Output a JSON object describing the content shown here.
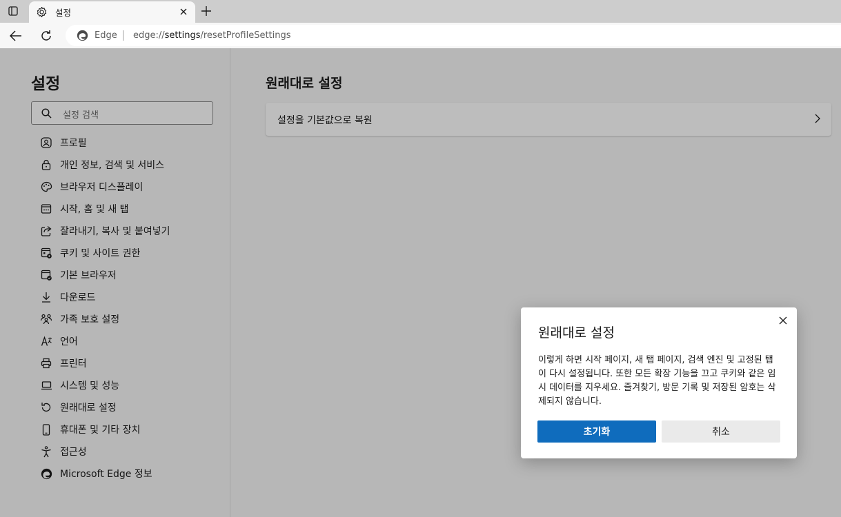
{
  "browser": {
    "tab": {
      "title": "설정",
      "icon": "gear-icon"
    },
    "address": {
      "brand": "Edge",
      "url_prefix": "edge://",
      "url_strong": "settings",
      "url_suffix": "/resetProfileSettings"
    }
  },
  "sidebar": {
    "title": "설정",
    "search_placeholder": "설정 검색",
    "items": [
      {
        "label": "프로필",
        "icon": "profile-icon"
      },
      {
        "label": "개인 정보, 검색 및 서비스",
        "icon": "lock-icon"
      },
      {
        "label": "브라우저 디스플레이",
        "icon": "palette-icon"
      },
      {
        "label": "시작, 홈 및 새 탭",
        "icon": "home-window-icon"
      },
      {
        "label": "잘라내기, 복사 및 붙여넣기",
        "icon": "share-icon"
      },
      {
        "label": "쿠키 및 사이트 권한",
        "icon": "cookie-permissions-icon"
      },
      {
        "label": "기본 브라우저",
        "icon": "default-browser-icon"
      },
      {
        "label": "다운로드",
        "icon": "download-icon"
      },
      {
        "label": "가족 보호 설정",
        "icon": "family-icon"
      },
      {
        "label": "언어",
        "icon": "language-icon"
      },
      {
        "label": "프린터",
        "icon": "printer-icon"
      },
      {
        "label": "시스템 및 성능",
        "icon": "laptop-icon"
      },
      {
        "label": "원래대로 설정",
        "icon": "reset-icon"
      },
      {
        "label": "휴대폰 및 기타 장치",
        "icon": "phone-icon"
      },
      {
        "label": "접근성",
        "icon": "accessibility-icon"
      },
      {
        "label": "Microsoft Edge 정보",
        "icon": "edge-logo-icon"
      }
    ]
  },
  "main": {
    "title": "원래대로 설정",
    "card_label": "설정을 기본값으로 복원"
  },
  "dialog": {
    "title": "원래대로 설정",
    "body": "이렇게 하면 시작 페이지, 새 탭 페이지, 검색 엔진 및 고정된 탭이 다시 설정됩니다. 또한 모든 확장 기능을 끄고 쿠키와 같은 임시 데이터를 지우세요. 즐겨찾기, 방문 기록 및 저장된 암호는 삭제되지 않습니다.",
    "primary_label": "초기화",
    "secondary_label": "취소"
  },
  "colors": {
    "accent": "#0f6cbd",
    "secondary_button": "#eaeaea",
    "tabstrip": "#cdcdcd"
  }
}
